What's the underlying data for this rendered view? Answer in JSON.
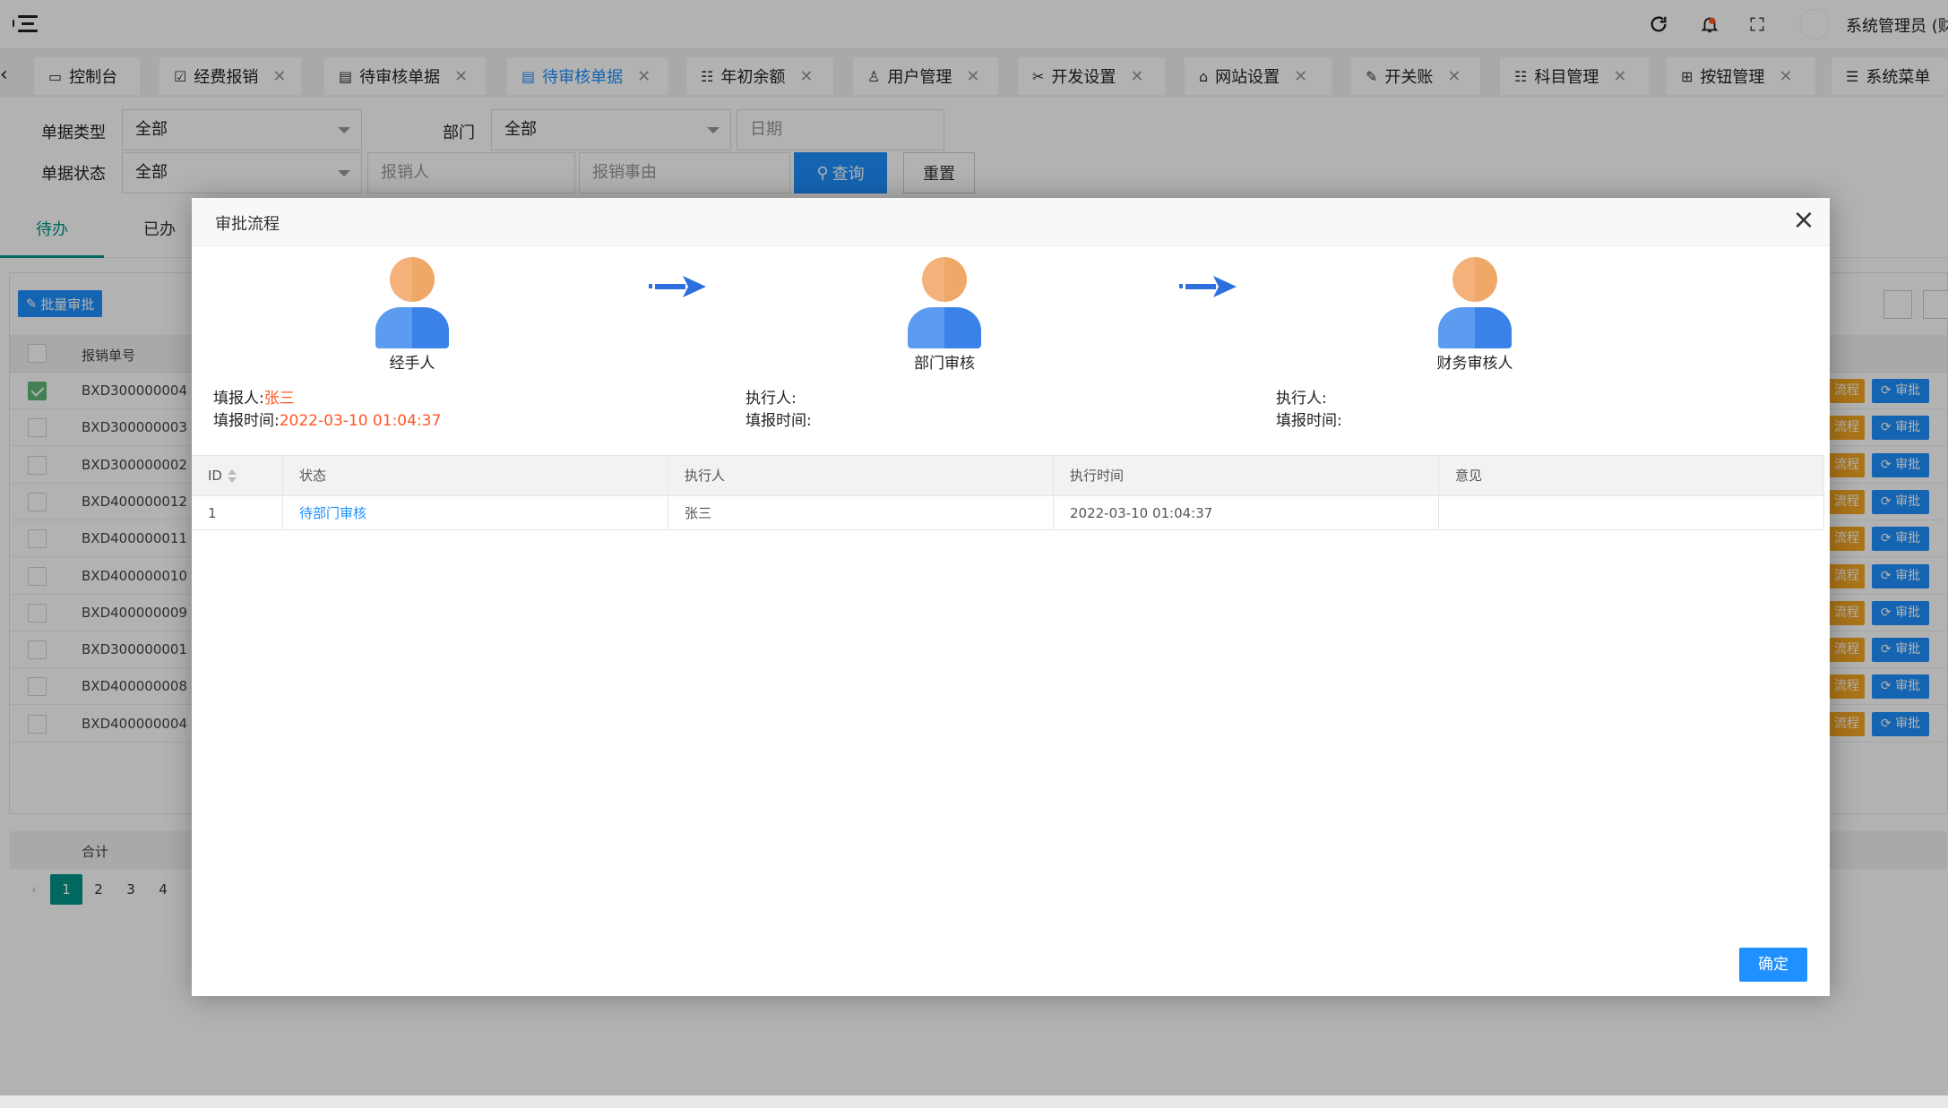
{
  "header": {
    "user_name": "系统管理员 (财"
  },
  "tabs": [
    {
      "label": "控制台",
      "icon": "monitor-icon",
      "closable": false
    },
    {
      "label": "经费报销",
      "icon": "form-icon",
      "closable": true
    },
    {
      "label": "待审核单据",
      "icon": "document-icon",
      "closable": true
    },
    {
      "label": "待审核单据",
      "icon": "document-icon",
      "closable": true,
      "active": true
    },
    {
      "label": "年初余额",
      "icon": "list-icon",
      "closable": true
    },
    {
      "label": "用户管理",
      "icon": "user-icon",
      "closable": true
    },
    {
      "label": "开发设置",
      "icon": "tools-icon",
      "closable": true
    },
    {
      "label": "网站设置",
      "icon": "home-icon",
      "closable": true
    },
    {
      "label": "开关账",
      "icon": "edit-icon",
      "closable": true
    },
    {
      "label": "科目管理",
      "icon": "list-icon",
      "closable": true
    },
    {
      "label": "按钮管理",
      "icon": "grid-icon",
      "closable": true
    },
    {
      "label": "系统菜单",
      "icon": "menu-icon",
      "closable": false
    }
  ],
  "filters": {
    "bill_type_label": "单据类型",
    "bill_type_value": "全部",
    "department_label": "部门",
    "department_value": "全部",
    "date_placeholder": "日期",
    "bill_status_label": "单据状态",
    "bill_status_value": "全部",
    "reporter_placeholder": "报销人",
    "reason_placeholder": "报销事由",
    "search_label": "查询",
    "reset_label": "重置"
  },
  "subtabs": {
    "todo": "待办",
    "done": "已办"
  },
  "table": {
    "batch_label": "批量审批",
    "col_no": "报销单号",
    "flow_label": "流程",
    "approve_label": "审批",
    "sum_label": "合计",
    "rows": [
      {
        "no": "BXD300000004",
        "checked": true
      },
      {
        "no": "BXD300000003",
        "checked": false
      },
      {
        "no": "BXD300000002",
        "checked": false
      },
      {
        "no": "BXD400000012",
        "checked": false
      },
      {
        "no": "BXD400000011",
        "checked": false
      },
      {
        "no": "BXD400000010",
        "checked": false
      },
      {
        "no": "BXD400000009",
        "checked": false
      },
      {
        "no": "BXD300000001",
        "checked": false
      },
      {
        "no": "BXD400000008",
        "checked": false
      },
      {
        "no": "BXD400000004",
        "checked": false
      }
    ],
    "pages": [
      "1",
      "2",
      "3",
      "4"
    ],
    "current_page": "1"
  },
  "modal": {
    "title": "审批流程",
    "steps": [
      {
        "label": "经手人"
      },
      {
        "label": "部门审核"
      },
      {
        "label": "财务审核人"
      }
    ],
    "info": [
      {
        "line1_label": "填报人:",
        "line1_value": "张三",
        "line2_label": "填报时间:",
        "line2_value": "2022-03-10 01:04:37"
      },
      {
        "line1_label": "执行人:",
        "line1_value": "",
        "line2_label": "填报时间:",
        "line2_value": ""
      },
      {
        "line1_label": "执行人:",
        "line1_value": "",
        "line2_label": "填报时间:",
        "line2_value": ""
      }
    ],
    "flow_table": {
      "headers": [
        "ID",
        "状态",
        "执行人",
        "执行时间",
        "意见"
      ],
      "rows": [
        {
          "id": "1",
          "status": "待部门审核",
          "executor": "张三",
          "time": "2022-03-10 01:04:37",
          "opinion": ""
        }
      ]
    },
    "confirm_label": "确定"
  },
  "colors": {
    "primary": "#1e90ff",
    "accent_green": "#009688",
    "warning": "#f5a623",
    "highlight_text": "#ff5722",
    "avatar_head": "#f4a460",
    "avatar_body": "#4a90e2"
  }
}
